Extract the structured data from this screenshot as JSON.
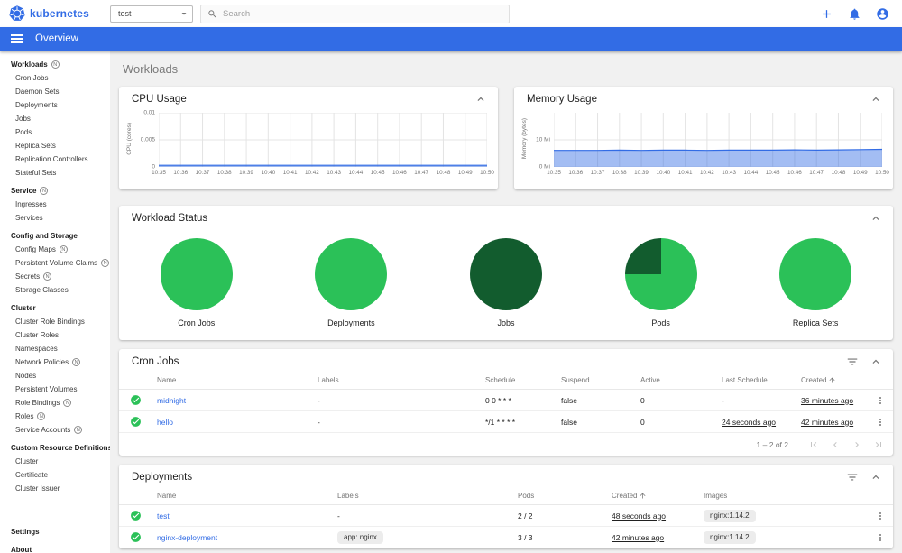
{
  "header": {
    "brand": "kubernetes",
    "namespace": "test",
    "search_placeholder": "Search"
  },
  "appbar": {
    "title": "Overview"
  },
  "sidebar": {
    "entries": [
      {
        "label": "Workloads",
        "type": "group",
        "badge": "N"
      },
      {
        "label": "Cron Jobs",
        "type": "item",
        "badge": ""
      },
      {
        "label": "Daemon Sets",
        "type": "item",
        "badge": ""
      },
      {
        "label": "Deployments",
        "type": "item",
        "badge": ""
      },
      {
        "label": "Jobs",
        "type": "item",
        "badge": ""
      },
      {
        "label": "Pods",
        "type": "item",
        "badge": ""
      },
      {
        "label": "Replica Sets",
        "type": "item",
        "badge": ""
      },
      {
        "label": "Replication Controllers",
        "type": "item",
        "badge": ""
      },
      {
        "label": "Stateful Sets",
        "type": "item",
        "badge": ""
      },
      {
        "label": "Service",
        "type": "group",
        "badge": "N"
      },
      {
        "label": "Ingresses",
        "type": "item",
        "badge": ""
      },
      {
        "label": "Services",
        "type": "item",
        "badge": ""
      },
      {
        "label": "Config and Storage",
        "type": "group",
        "badge": ""
      },
      {
        "label": "Config Maps",
        "type": "item",
        "badge": "N"
      },
      {
        "label": "Persistent Volume Claims",
        "type": "item",
        "badge": "N"
      },
      {
        "label": "Secrets",
        "type": "item",
        "badge": "N"
      },
      {
        "label": "Storage Classes",
        "type": "item",
        "badge": ""
      },
      {
        "label": "Cluster",
        "type": "group",
        "badge": ""
      },
      {
        "label": "Cluster Role Bindings",
        "type": "item",
        "badge": ""
      },
      {
        "label": "Cluster Roles",
        "type": "item",
        "badge": ""
      },
      {
        "label": "Namespaces",
        "type": "item",
        "badge": ""
      },
      {
        "label": "Network Policies",
        "type": "item",
        "badge": "N"
      },
      {
        "label": "Nodes",
        "type": "item",
        "badge": ""
      },
      {
        "label": "Persistent Volumes",
        "type": "item",
        "badge": ""
      },
      {
        "label": "Role Bindings",
        "type": "item",
        "badge": "N"
      },
      {
        "label": "Roles",
        "type": "item",
        "badge": "N"
      },
      {
        "label": "Service Accounts",
        "type": "item",
        "badge": "N"
      },
      {
        "label": "Custom Resource Definitions",
        "type": "group",
        "badge": ""
      },
      {
        "label": "Cluster",
        "type": "item",
        "badge": ""
      },
      {
        "label": "Certificate",
        "type": "item",
        "badge": ""
      },
      {
        "label": "Cluster Issuer",
        "type": "item",
        "badge": ""
      }
    ],
    "footer": [
      {
        "label": "Settings"
      },
      {
        "label": "About"
      }
    ]
  },
  "page": {
    "title": "Workloads"
  },
  "colors": {
    "brand_blue": "#326ce5",
    "green": "#2bc158",
    "dark_green": "#125c2e",
    "content_bg": "#f1f1f1"
  },
  "cpu_card": {
    "title": "CPU Usage",
    "chart_data": {
      "type": "area",
      "title": "CPU Usage",
      "ylabel": "CPU (cores)",
      "x": [
        "10:35",
        "10:36",
        "10:37",
        "10:38",
        "10:39",
        "10:40",
        "10:41",
        "10:42",
        "10:43",
        "10:44",
        "10:45",
        "10:46",
        "10:47",
        "10:48",
        "10:49",
        "10:50"
      ],
      "y_ticks": [
        {
          "label": "0.01",
          "value": 0.01
        },
        {
          "label": "0.005",
          "value": 0.005
        },
        {
          "label": "0",
          "value": 0
        }
      ],
      "ylim": [
        0,
        0.01
      ],
      "grid": true,
      "legend": false,
      "series": [
        {
          "name": "CPU Usage",
          "values": [
            0.0003,
            0.0003,
            0.0003,
            0.0003,
            0.0003,
            0.0003,
            0.0003,
            0.0003,
            0.0003,
            0.0003,
            0.0003,
            0.0003,
            0.0003,
            0.0003,
            0.0003,
            0.0003
          ]
        }
      ],
      "color": "#326ce5"
    }
  },
  "memory_card": {
    "title": "Memory Usage",
    "chart_data": {
      "type": "area",
      "title": "Memory Usage",
      "ylabel": "Memory (bytes)",
      "x": [
        "10:35",
        "10:36",
        "10:37",
        "10:38",
        "10:39",
        "10:40",
        "10:41",
        "10:42",
        "10:43",
        "10:44",
        "10:45",
        "10:46",
        "10:47",
        "10:48",
        "10:49",
        "10:50"
      ],
      "y_ticks": [
        {
          "label": "10 Mi",
          "value": 10
        },
        {
          "label": "0 Mi",
          "value": 0
        }
      ],
      "ylim": [
        0,
        20
      ],
      "grid": true,
      "legend": false,
      "series": [
        {
          "name": "Memory Usage",
          "values": [
            6.1,
            6.1,
            6.1,
            6.2,
            6.1,
            6.2,
            6.2,
            6.1,
            6.2,
            6.2,
            6.2,
            6.3,
            6.2,
            6.3,
            6.4,
            6.5
          ]
        }
      ],
      "color": "#326ce5"
    }
  },
  "workload_status": {
    "title": "Workload Status",
    "chart_data": {
      "type": "pie",
      "charts": [
        {
          "label": "Cron Jobs",
          "segments": [
            {
              "name": "Running",
              "color": "#2bc158",
              "pct": 100
            }
          ],
          "start_deg": 0
        },
        {
          "label": "Deployments",
          "segments": [
            {
              "name": "Running",
              "color": "#2bc158",
              "pct": 100
            }
          ],
          "start_deg": 0
        },
        {
          "label": "Jobs",
          "segments": [
            {
              "name": "Succeeded",
              "color": "#125c2e",
              "pct": 100
            }
          ],
          "start_deg": 0
        },
        {
          "label": "Pods",
          "segments": [
            {
              "name": "Succeeded",
              "color": "#125c2e",
              "pct": 25
            },
            {
              "name": "Running",
              "color": "#2bc158",
              "pct": 75
            }
          ],
          "start_deg": 270
        },
        {
          "label": "Replica Sets",
          "segments": [
            {
              "name": "Running",
              "color": "#2bc158",
              "pct": 100
            }
          ],
          "start_deg": 0
        }
      ]
    }
  },
  "cron_jobs": {
    "title": "Cron Jobs",
    "columns": {
      "name": "Name",
      "labels": "Labels",
      "schedule": "Schedule",
      "suspend": "Suspend",
      "active": "Active",
      "last_schedule": "Last Schedule",
      "created": "Created"
    },
    "rows": [
      {
        "name": "midnight",
        "labels": "-",
        "schedule": "0 0 * * *",
        "suspend": "false",
        "active": "0",
        "last_schedule": "-",
        "created": "36 minutes ago"
      },
      {
        "name": "hello",
        "labels": "-",
        "schedule": "*/1 * * * *",
        "suspend": "false",
        "active": "0",
        "last_schedule": "24 seconds ago",
        "created": "42 minutes ago"
      }
    ],
    "pagination": "1 – 2 of 2"
  },
  "deployments": {
    "title": "Deployments",
    "columns": {
      "name": "Name",
      "labels": "Labels",
      "pods": "Pods",
      "created": "Created",
      "images": "Images"
    },
    "rows": [
      {
        "name": "test",
        "labels_text": "-",
        "labels_chip": "",
        "pods": "2 / 2",
        "created": "48 seconds ago",
        "image": "nginx:1.14.2"
      },
      {
        "name": "nginx-deployment",
        "labels_text": "",
        "labels_chip": "app: nginx",
        "pods": "3 / 3",
        "created": "42 minutes ago",
        "image": "nginx:1.14.2"
      }
    ]
  }
}
